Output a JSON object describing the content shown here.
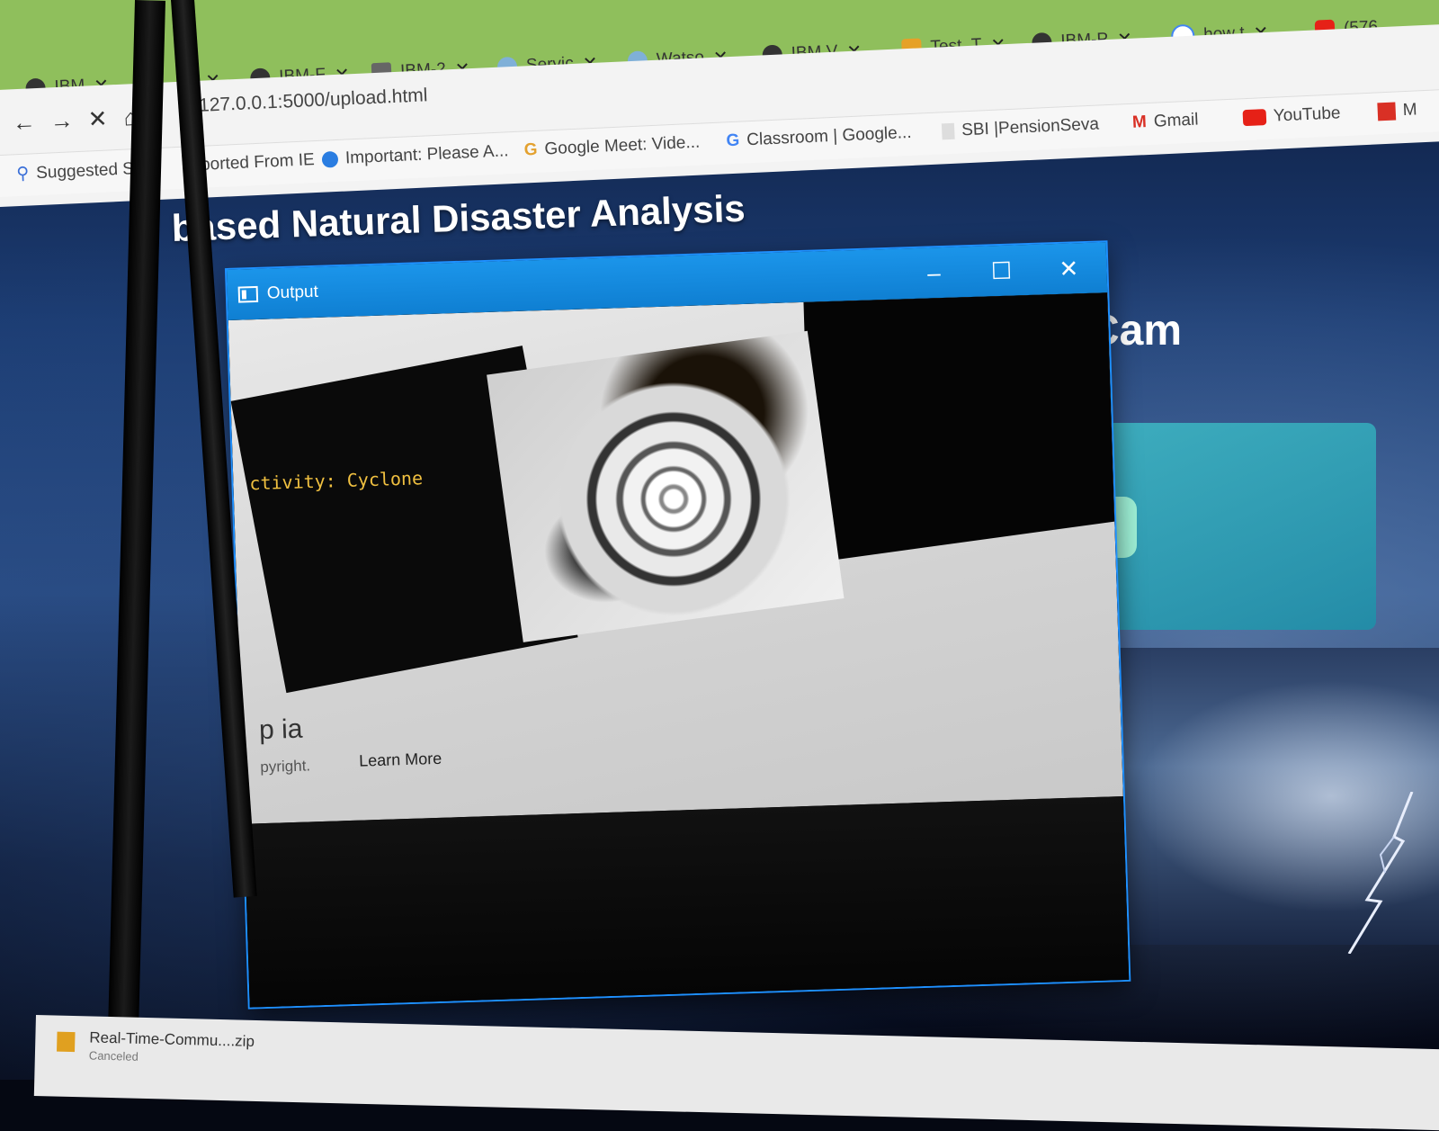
{
  "browser": {
    "tabs": [
      {
        "label": "IBM",
        "icon": "globe-icon"
      },
      {
        "label": "",
        "icon": ""
      },
      {
        "label": "IBM-F",
        "icon": "github-icon"
      },
      {
        "label": "IBM-2",
        "icon": "document-icon"
      },
      {
        "label": "Servic",
        "icon": "cloud-icon"
      },
      {
        "label": "Watso",
        "icon": "cloud-icon"
      },
      {
        "label": "IBM V",
        "icon": "gear-icon"
      },
      {
        "label": "Test_T",
        "icon": "tag-icon"
      },
      {
        "label": "IBM-P",
        "icon": "github-icon"
      },
      {
        "label": "how t",
        "icon": "google-icon"
      },
      {
        "label": "(576",
        "icon": "youtube-icon"
      }
    ],
    "url": "127.0.0.1:5000/upload.html",
    "bookmarks": [
      {
        "label": "Suggested Sites",
        "icon": "search-icon",
        "color": "#3a6fd8"
      },
      {
        "label": "ported From IE",
        "icon": "folder-icon",
        "color": "#e6b040"
      },
      {
        "label": "Important: Please A...",
        "icon": "edge-icon",
        "color": "#2a7de1"
      },
      {
        "label": "Google Meet: Vide...",
        "icon": "google-icon",
        "color": "#e3a12f"
      },
      {
        "label": "Classroom | Google...",
        "icon": "google-icon",
        "color": "#4285f4"
      },
      {
        "label": "SBI |PensionSeva",
        "icon": "page-icon",
        "color": "#bbbbbb"
      },
      {
        "label": "Gmail",
        "icon": "gmail-icon",
        "color": "#d93025"
      },
      {
        "label": "YouTube",
        "icon": "youtube-icon",
        "color": "#e62117"
      },
      {
        "label": "M",
        "icon": "bookmark-icon",
        "color": "#d93025"
      }
    ]
  },
  "page": {
    "heading": "Al based Natural Disaster Analysis",
    "heading_visible": "based Natural Disaster Analysis",
    "cam_label": "Cam"
  },
  "output_window": {
    "title": "Output",
    "activity_label": "ctivity: Cyclone",
    "wiki_fragment": "p  ia",
    "copyright_fragment": "pyright.",
    "learn_more": "Learn More"
  },
  "downloads": {
    "file": "Real-Time-Commu....zip",
    "status": "Canceled"
  },
  "colors": {
    "tab_strip": "#8fbf5c",
    "window_title": "#1b95ea",
    "activity_text": "#f0c040"
  }
}
